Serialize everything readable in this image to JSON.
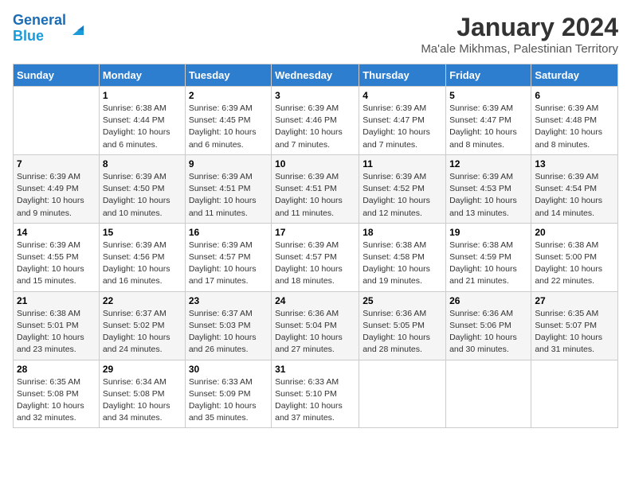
{
  "header": {
    "logo_line1": "General",
    "logo_line2": "Blue",
    "title": "January 2024",
    "subtitle": "Ma'ale Mikhmas, Palestinian Territory"
  },
  "days_of_week": [
    "Sunday",
    "Monday",
    "Tuesday",
    "Wednesday",
    "Thursday",
    "Friday",
    "Saturday"
  ],
  "weeks": [
    [
      {
        "num": "",
        "sunrise": "",
        "sunset": "",
        "daylight": ""
      },
      {
        "num": "1",
        "sunrise": "Sunrise: 6:38 AM",
        "sunset": "Sunset: 4:44 PM",
        "daylight": "Daylight: 10 hours and 6 minutes."
      },
      {
        "num": "2",
        "sunrise": "Sunrise: 6:39 AM",
        "sunset": "Sunset: 4:45 PM",
        "daylight": "Daylight: 10 hours and 6 minutes."
      },
      {
        "num": "3",
        "sunrise": "Sunrise: 6:39 AM",
        "sunset": "Sunset: 4:46 PM",
        "daylight": "Daylight: 10 hours and 7 minutes."
      },
      {
        "num": "4",
        "sunrise": "Sunrise: 6:39 AM",
        "sunset": "Sunset: 4:47 PM",
        "daylight": "Daylight: 10 hours and 7 minutes."
      },
      {
        "num": "5",
        "sunrise": "Sunrise: 6:39 AM",
        "sunset": "Sunset: 4:47 PM",
        "daylight": "Daylight: 10 hours and 8 minutes."
      },
      {
        "num": "6",
        "sunrise": "Sunrise: 6:39 AM",
        "sunset": "Sunset: 4:48 PM",
        "daylight": "Daylight: 10 hours and 8 minutes."
      }
    ],
    [
      {
        "num": "7",
        "sunrise": "Sunrise: 6:39 AM",
        "sunset": "Sunset: 4:49 PM",
        "daylight": "Daylight: 10 hours and 9 minutes."
      },
      {
        "num": "8",
        "sunrise": "Sunrise: 6:39 AM",
        "sunset": "Sunset: 4:50 PM",
        "daylight": "Daylight: 10 hours and 10 minutes."
      },
      {
        "num": "9",
        "sunrise": "Sunrise: 6:39 AM",
        "sunset": "Sunset: 4:51 PM",
        "daylight": "Daylight: 10 hours and 11 minutes."
      },
      {
        "num": "10",
        "sunrise": "Sunrise: 6:39 AM",
        "sunset": "Sunset: 4:51 PM",
        "daylight": "Daylight: 10 hours and 11 minutes."
      },
      {
        "num": "11",
        "sunrise": "Sunrise: 6:39 AM",
        "sunset": "Sunset: 4:52 PM",
        "daylight": "Daylight: 10 hours and 12 minutes."
      },
      {
        "num": "12",
        "sunrise": "Sunrise: 6:39 AM",
        "sunset": "Sunset: 4:53 PM",
        "daylight": "Daylight: 10 hours and 13 minutes."
      },
      {
        "num": "13",
        "sunrise": "Sunrise: 6:39 AM",
        "sunset": "Sunset: 4:54 PM",
        "daylight": "Daylight: 10 hours and 14 minutes."
      }
    ],
    [
      {
        "num": "14",
        "sunrise": "Sunrise: 6:39 AM",
        "sunset": "Sunset: 4:55 PM",
        "daylight": "Daylight: 10 hours and 15 minutes."
      },
      {
        "num": "15",
        "sunrise": "Sunrise: 6:39 AM",
        "sunset": "Sunset: 4:56 PM",
        "daylight": "Daylight: 10 hours and 16 minutes."
      },
      {
        "num": "16",
        "sunrise": "Sunrise: 6:39 AM",
        "sunset": "Sunset: 4:57 PM",
        "daylight": "Daylight: 10 hours and 17 minutes."
      },
      {
        "num": "17",
        "sunrise": "Sunrise: 6:39 AM",
        "sunset": "Sunset: 4:57 PM",
        "daylight": "Daylight: 10 hours and 18 minutes."
      },
      {
        "num": "18",
        "sunrise": "Sunrise: 6:38 AM",
        "sunset": "Sunset: 4:58 PM",
        "daylight": "Daylight: 10 hours and 19 minutes."
      },
      {
        "num": "19",
        "sunrise": "Sunrise: 6:38 AM",
        "sunset": "Sunset: 4:59 PM",
        "daylight": "Daylight: 10 hours and 21 minutes."
      },
      {
        "num": "20",
        "sunrise": "Sunrise: 6:38 AM",
        "sunset": "Sunset: 5:00 PM",
        "daylight": "Daylight: 10 hours and 22 minutes."
      }
    ],
    [
      {
        "num": "21",
        "sunrise": "Sunrise: 6:38 AM",
        "sunset": "Sunset: 5:01 PM",
        "daylight": "Daylight: 10 hours and 23 minutes."
      },
      {
        "num": "22",
        "sunrise": "Sunrise: 6:37 AM",
        "sunset": "Sunset: 5:02 PM",
        "daylight": "Daylight: 10 hours and 24 minutes."
      },
      {
        "num": "23",
        "sunrise": "Sunrise: 6:37 AM",
        "sunset": "Sunset: 5:03 PM",
        "daylight": "Daylight: 10 hours and 26 minutes."
      },
      {
        "num": "24",
        "sunrise": "Sunrise: 6:36 AM",
        "sunset": "Sunset: 5:04 PM",
        "daylight": "Daylight: 10 hours and 27 minutes."
      },
      {
        "num": "25",
        "sunrise": "Sunrise: 6:36 AM",
        "sunset": "Sunset: 5:05 PM",
        "daylight": "Daylight: 10 hours and 28 minutes."
      },
      {
        "num": "26",
        "sunrise": "Sunrise: 6:36 AM",
        "sunset": "Sunset: 5:06 PM",
        "daylight": "Daylight: 10 hours and 30 minutes."
      },
      {
        "num": "27",
        "sunrise": "Sunrise: 6:35 AM",
        "sunset": "Sunset: 5:07 PM",
        "daylight": "Daylight: 10 hours and 31 minutes."
      }
    ],
    [
      {
        "num": "28",
        "sunrise": "Sunrise: 6:35 AM",
        "sunset": "Sunset: 5:08 PM",
        "daylight": "Daylight: 10 hours and 32 minutes."
      },
      {
        "num": "29",
        "sunrise": "Sunrise: 6:34 AM",
        "sunset": "Sunset: 5:08 PM",
        "daylight": "Daylight: 10 hours and 34 minutes."
      },
      {
        "num": "30",
        "sunrise": "Sunrise: 6:33 AM",
        "sunset": "Sunset: 5:09 PM",
        "daylight": "Daylight: 10 hours and 35 minutes."
      },
      {
        "num": "31",
        "sunrise": "Sunrise: 6:33 AM",
        "sunset": "Sunset: 5:10 PM",
        "daylight": "Daylight: 10 hours and 37 minutes."
      },
      {
        "num": "",
        "sunrise": "",
        "sunset": "",
        "daylight": ""
      },
      {
        "num": "",
        "sunrise": "",
        "sunset": "",
        "daylight": ""
      },
      {
        "num": "",
        "sunrise": "",
        "sunset": "",
        "daylight": ""
      }
    ]
  ]
}
